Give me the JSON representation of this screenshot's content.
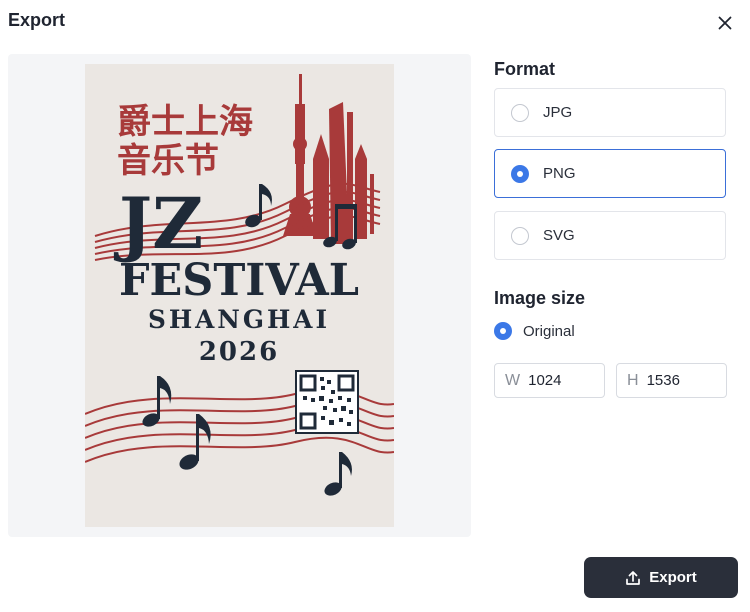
{
  "dialog": {
    "title": "Export",
    "close_icon": "close-icon"
  },
  "preview": {
    "poster": {
      "chinese_line1": "爵士上海",
      "chinese_line2": "音乐节",
      "monogram": "JZ",
      "festival": "FESTIVAL",
      "city": "SHANGHAI",
      "year": "2026",
      "colors": {
        "background": "#ebe7e3",
        "accent_red": "#a83a3a",
        "navy": "#1f2a38"
      }
    }
  },
  "format": {
    "heading": "Format",
    "options": [
      {
        "label": "JPG",
        "selected": false
      },
      {
        "label": "PNG",
        "selected": true
      },
      {
        "label": "SVG",
        "selected": false
      }
    ]
  },
  "image_size": {
    "heading": "Image size",
    "original_label": "Original",
    "original_selected": true,
    "width_prefix": "W",
    "width_value": "1024",
    "height_prefix": "H",
    "height_value": "1536"
  },
  "footer": {
    "export_label": "Export",
    "export_icon": "upload-icon"
  },
  "theme": {
    "accent": "#3b78e7",
    "button_dark": "#2a2f3a"
  }
}
